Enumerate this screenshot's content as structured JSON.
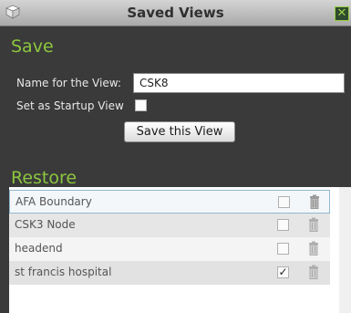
{
  "window": {
    "title": "Saved Views",
    "close_glyph": "✕",
    "icon": "app-icon"
  },
  "save": {
    "heading": "Save",
    "name_label": "Name for the View:",
    "name_value": "CSK8",
    "startup_label": "Set as Startup View",
    "startup_checked": false,
    "button_label": "Save this View"
  },
  "restore": {
    "heading": "Restore",
    "items": [
      {
        "label": "AFA Boundary",
        "checked": false,
        "check_glyph": ""
      },
      {
        "label": "CSK3 Node",
        "checked": false,
        "check_glyph": ""
      },
      {
        "label": "headend",
        "checked": false,
        "check_glyph": ""
      },
      {
        "label": "st francis hospital",
        "checked": true,
        "check_glyph": "✓"
      }
    ]
  },
  "colors": {
    "accent": "#8cc63f",
    "panel_bg": "#3a3a3a"
  }
}
